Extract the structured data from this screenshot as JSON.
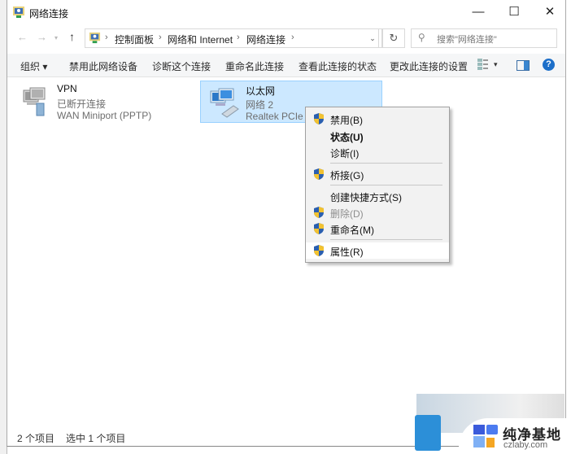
{
  "window": {
    "title": "网络连接",
    "controls": {
      "minimize": "—",
      "maximize": "☐",
      "close": "✕"
    }
  },
  "navigation": {
    "back": "←",
    "forward": "→",
    "recent": "▾",
    "up": "↑",
    "breadcrumb": [
      "控制面板",
      "网络和 Internet",
      "网络连接"
    ],
    "separator": "›",
    "dropdown": "⌄",
    "refresh": "↻",
    "search_placeholder": "搜索\"网络连接\""
  },
  "toolbar": {
    "organize": "组织 ▾",
    "items": [
      "禁用此网络设备",
      "诊断这个连接",
      "重命名此连接",
      "查看此连接的状态",
      "更改此连接的设置"
    ],
    "view_dropdown": "▾",
    "help": "?"
  },
  "connections": [
    {
      "name": "VPN",
      "status": "已断开连接",
      "device": "WAN Miniport (PPTP)",
      "selected": false
    },
    {
      "name": "以太网",
      "status": "网络 2",
      "device": "Realtek PCIe GbE Family Controller",
      "selected": true
    }
  ],
  "context_menu": {
    "items": [
      {
        "label": "禁用(B)",
        "shield": true,
        "bold": false,
        "disabled": false
      },
      {
        "label": "状态(U)",
        "shield": false,
        "bold": true,
        "disabled": false
      },
      {
        "label": "诊断(I)",
        "shield": false,
        "bold": false,
        "disabled": false
      },
      {
        "label": "桥接(G)",
        "shield": true,
        "bold": false,
        "disabled": false
      },
      {
        "label": "创建快捷方式(S)",
        "shield": false,
        "bold": false,
        "disabled": false
      },
      {
        "label": "删除(D)",
        "shield": true,
        "bold": false,
        "disabled": true
      },
      {
        "label": "重命名(M)",
        "shield": true,
        "bold": false,
        "disabled": false
      },
      {
        "label": "属性(R)",
        "shield": true,
        "bold": false,
        "disabled": false,
        "highlighted": true
      }
    ]
  },
  "statusbar": {
    "item_count": "2 个项目",
    "selected_count": "选中 1 个项目"
  },
  "watermark": {
    "title": "纯净基地",
    "url": "czlaby.com"
  },
  "colors": {
    "selection_bg": "#cce8ff",
    "selection_border": "#99d1ff",
    "help_blue": "#1d6fc9"
  }
}
